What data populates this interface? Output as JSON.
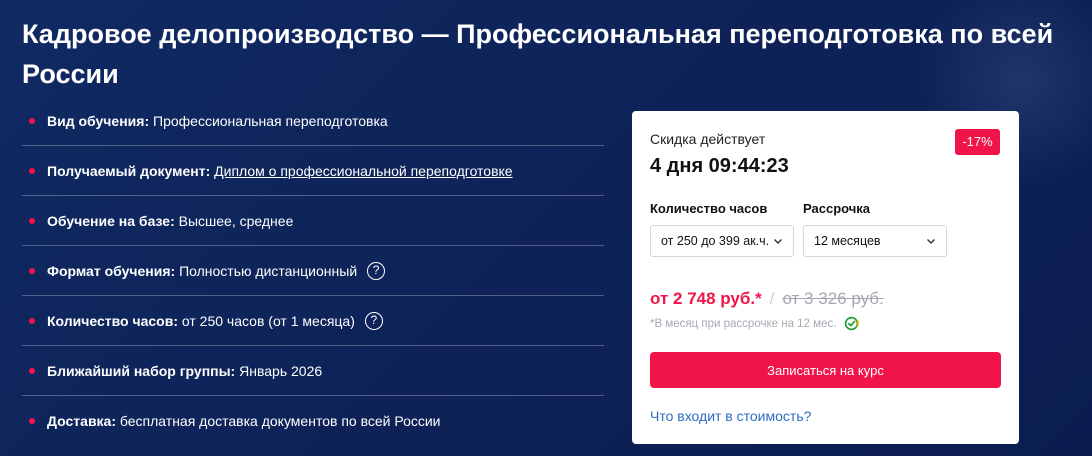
{
  "title": "Кадровое делопроизводство — Профессиональная переподготовка по всей России",
  "features": [
    {
      "label": "Вид обучения:",
      "value": "Профессиональная переподготовка"
    },
    {
      "label": "Получаемый документ:",
      "value": "Диплом о профессиональной переподготовке"
    },
    {
      "label": "Обучение на базе:",
      "value": "Высшее, среднее"
    },
    {
      "label": "Формат обучения:",
      "value": "Полностью дистанционный",
      "help": "?"
    },
    {
      "label": "Количество часов:",
      "value": "от 250 часов (от 1 месяца)",
      "help": "?"
    },
    {
      "label": "Ближайший набор группы:",
      "value": "Январь 2026"
    },
    {
      "label": "Доставка:",
      "value": "бесплатная доставка документов по всей России"
    }
  ],
  "card": {
    "discount_label": "Скидка действует",
    "countdown": "4 дня 09:44:23",
    "badge": "-17%",
    "hours_label": "Количество часов",
    "hours_value": "от 250 до 399 ак.ч.",
    "installment_label": "Рассрочка",
    "installment_value": "12 месяцев",
    "price_new": "от 2 748 руб.*",
    "price_sep": "/",
    "price_old": "от 3 326 руб.",
    "note": "*В месяц при рассрочке на 12 мес.",
    "cta": "Записаться на курс",
    "includes_link": "Что входит в стоимость?"
  },
  "colors": {
    "background": "#0e2359",
    "accent": "#f0144a",
    "link": "#2d6cc4"
  },
  "icons": [
    "bullet-dot",
    "help-circle-icon",
    "chevron-down-icon",
    "sber-check-icon"
  ]
}
